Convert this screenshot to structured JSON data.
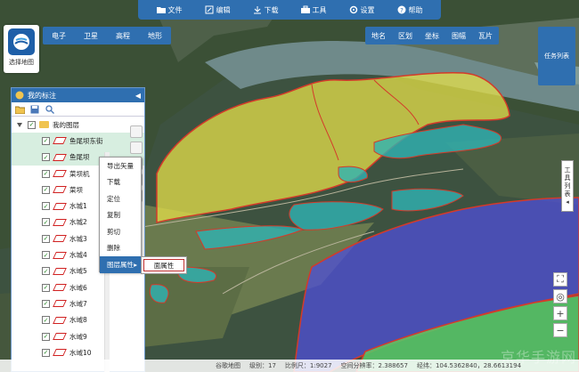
{
  "toolbar": [
    {
      "label": "文件",
      "icon": "folder-icon"
    },
    {
      "label": "编辑",
      "icon": "edit-icon"
    },
    {
      "label": "下载",
      "icon": "download-icon"
    },
    {
      "label": "工具",
      "icon": "toolbox-icon"
    },
    {
      "label": "设置",
      "icon": "gear-icon"
    },
    {
      "label": "帮助",
      "icon": "help-icon"
    }
  ],
  "select_map": {
    "label": "选择地图"
  },
  "map_types": [
    "电子",
    "卫星",
    "高程",
    "地形"
  ],
  "overlays": [
    "地名",
    "区划",
    "坐标",
    "图幅",
    "瓦片"
  ],
  "task_list": "任务列表",
  "tool_tab": [
    "工",
    "具",
    "列",
    "表"
  ],
  "panel": {
    "title": "我的标注",
    "root": "我的图层",
    "layers": [
      "鱼尾坝东街",
      "鱼尾坝",
      "菜坝机",
      "菜坝",
      "水城1",
      "水城2",
      "水城3",
      "水城4",
      "水域5",
      "水域6",
      "水域7",
      "水域8",
      "水域9",
      "水域10"
    ]
  },
  "context_menu": {
    "items": [
      "导出矢量",
      "下载",
      "定位",
      "复制",
      "剪切",
      "删除"
    ],
    "highlight": "图层属性",
    "submenu": "面属性"
  },
  "status": {
    "source": "谷歌地图",
    "level": "级别：17",
    "scale": "比例尺：1:9027",
    "resolution": "空间分辨率：2.388657",
    "coords": "经纬：104.5362840，28.6613194"
  },
  "watermark": "京华手游网",
  "colors": {
    "toolbar": "#2f6fb0",
    "highlight": "#2f6fb0",
    "yellow_area": "#e6e04a",
    "cyan_area": "#2fb3b3",
    "blue_area": "#4f4fd8",
    "green_area": "#58c96a"
  }
}
